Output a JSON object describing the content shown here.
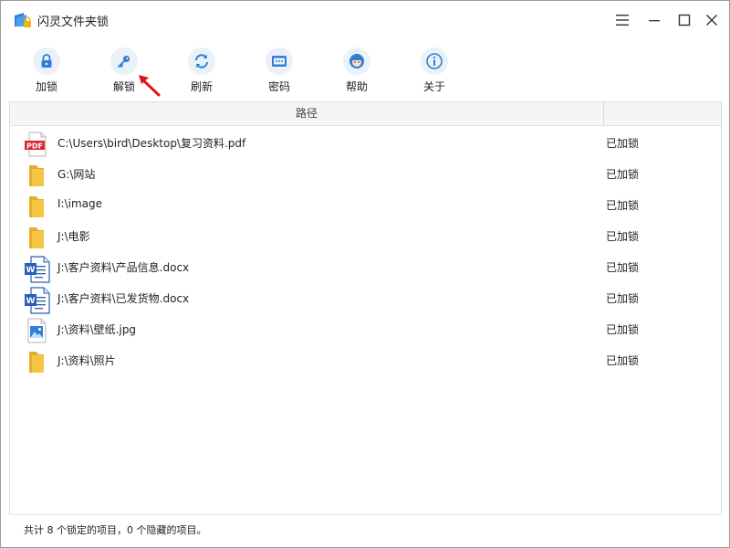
{
  "window": {
    "title": "闪灵文件夹锁"
  },
  "toolbar": {
    "items": [
      {
        "label": "加锁",
        "icon": "lock-icon"
      },
      {
        "label": "解锁",
        "icon": "key-icon"
      },
      {
        "label": "刷新",
        "icon": "refresh-icon"
      },
      {
        "label": "密码",
        "icon": "password-icon"
      },
      {
        "label": "帮助",
        "icon": "help-icon"
      },
      {
        "label": "关于",
        "icon": "info-icon"
      }
    ]
  },
  "list": {
    "columns": {
      "path": "路径",
      "status": ""
    },
    "rows": [
      {
        "path": "C:\\Users\\bird\\Desktop\\复习资料.pdf",
        "status": "已加锁",
        "icon": "pdf-file-icon"
      },
      {
        "path": "G:\\网站",
        "status": "已加锁",
        "icon": "folder-icon"
      },
      {
        "path": "I:\\image",
        "status": "已加锁",
        "icon": "folder-icon"
      },
      {
        "path": "J:\\电影",
        "status": "已加锁",
        "icon": "folder-icon"
      },
      {
        "path": "J:\\客户资料\\产品信息.docx",
        "status": "已加锁",
        "icon": "word-file-icon"
      },
      {
        "path": "J:\\客户资料\\已发货物.docx",
        "status": "已加锁",
        "icon": "word-file-icon"
      },
      {
        "path": "J:\\资料\\壁纸.jpg",
        "status": "已加锁",
        "icon": "image-file-icon"
      },
      {
        "path": "J:\\资料\\照片",
        "status": "已加锁",
        "icon": "folder-icon"
      }
    ]
  },
  "statusbar": {
    "text": "共计 8 个锁定的项目，0 个隐藏的项目。"
  },
  "colors": {
    "accent": "#2f7fd6",
    "folder": "#f5c542",
    "pdf": "#d9262c",
    "word": "#2b5fb8",
    "arrow": "#e0151b"
  }
}
